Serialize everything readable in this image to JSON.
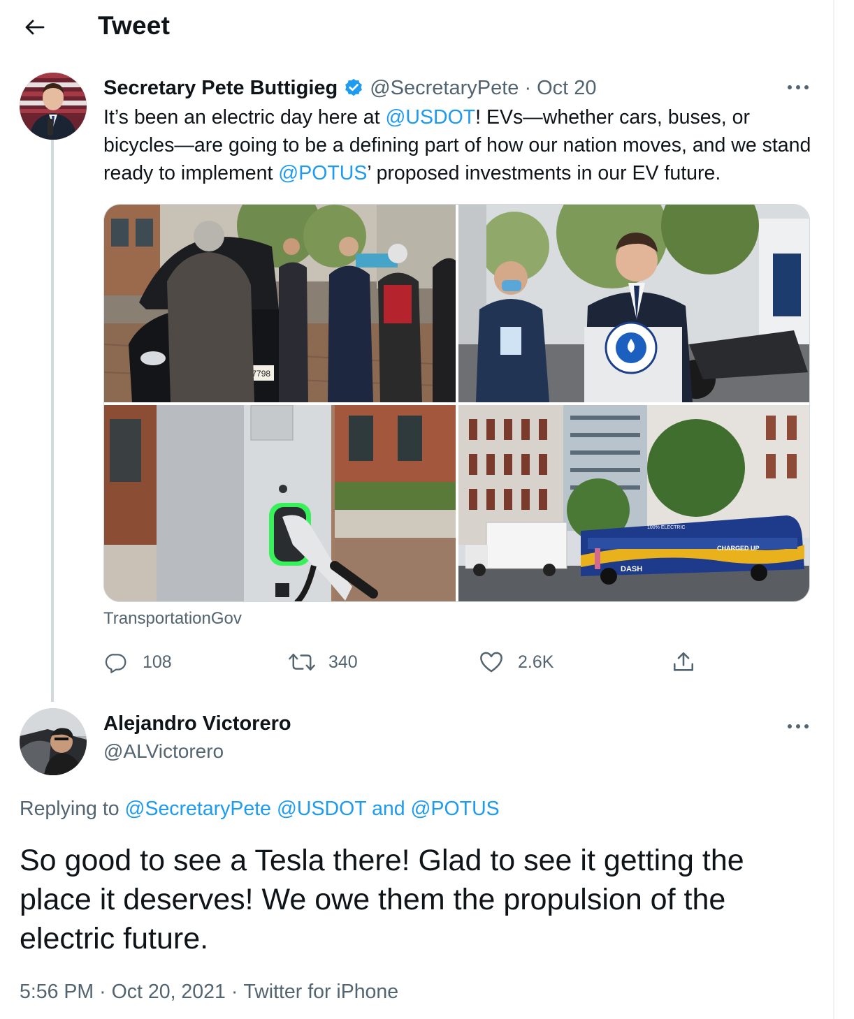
{
  "header": {
    "title": "Tweet"
  },
  "tweet": {
    "author_name": "Secretary Pete Buttigieg",
    "author_handle": "@SecretaryPete",
    "date": "Oct 20",
    "separator": "·",
    "text_parts": {
      "p1": "It’s been an electric day here at ",
      "m1": "@USDOT",
      "p2": "! EVs—whether cars, buses, or bicycles—are going to be a defining part of how our nation moves, and we stand ready to implement ",
      "m2": "@POTUS",
      "p3": "’ proposed investments in our EV future."
    },
    "media_source": "TransportationGov",
    "stats": {
      "replies": "108",
      "retweets": "340",
      "likes": "2.6K"
    },
    "photo_labels": {
      "plate": "687798",
      "bus": "DASH",
      "bus_slogan": "CHARGED UP",
      "bus_banner": "100% ELECTRIC"
    }
  },
  "reply": {
    "author_name": "Alejandro Victorero",
    "author_handle": "@ALVictorero",
    "replying_prefix": "Replying to ",
    "replying_to_1": "@SecretaryPete",
    "replying_to_2": "@USDOT",
    "replying_and": "and",
    "replying_to_3": "@POTUS",
    "text": "So good to see a Tesla there! Glad to see it getting the place it deserves! We owe them the propulsion of the electric future.",
    "time": "5:56 PM",
    "date": "Oct 20, 2021",
    "client": "Twitter for iPhone",
    "separator": "·"
  },
  "colors": {
    "accent": "#1d9bf0",
    "text": "#0f1419",
    "secondary": "#536471",
    "border": "#cfd9de"
  },
  "icons": [
    "back-arrow-icon",
    "verified-badge-icon",
    "more-icon",
    "reply-icon",
    "retweet-icon",
    "like-icon",
    "share-icon"
  ]
}
